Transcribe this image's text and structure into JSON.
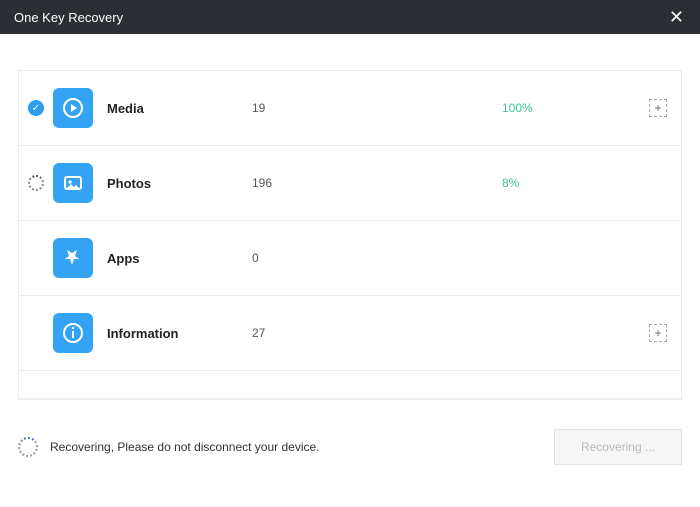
{
  "title": "One Key Recovery",
  "rows": [
    {
      "label": "Media",
      "count": "19",
      "pct": "100%",
      "status": "done",
      "expand": true
    },
    {
      "label": "Photos",
      "count": "196",
      "pct": "8%",
      "status": "working",
      "expand": false
    },
    {
      "label": "Apps",
      "count": "0",
      "pct": "",
      "status": "none",
      "expand": false
    },
    {
      "label": "Information",
      "count": "27",
      "pct": "",
      "status": "none",
      "expand": true
    }
  ],
  "footer": {
    "message": "Recovering, Please do not disconnect your device.",
    "button": "Recovering ..."
  }
}
